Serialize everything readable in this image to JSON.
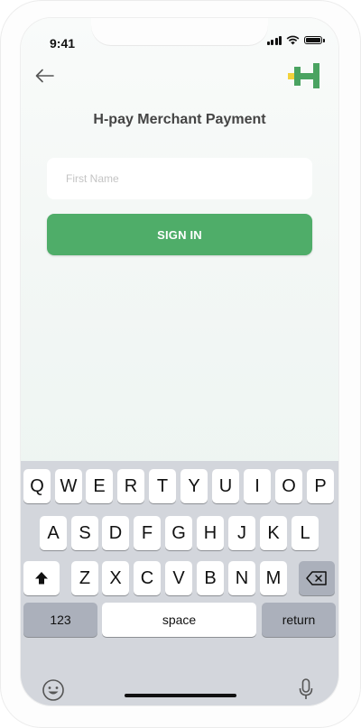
{
  "status_bar": {
    "time": "9:41"
  },
  "header": {
    "back_icon": "arrow-left-icon",
    "logo": "h-pay-logo",
    "title": "H-pay Merchant Payment"
  },
  "form": {
    "first_name": {
      "placeholder": "First Name",
      "value": ""
    },
    "submit_label": "SIGN IN"
  },
  "keyboard": {
    "row1": [
      "Q",
      "W",
      "E",
      "R",
      "T",
      "Y",
      "U",
      "I",
      "O",
      "P"
    ],
    "row2": [
      "A",
      "S",
      "D",
      "F",
      "G",
      "H",
      "J",
      "K",
      "L"
    ],
    "row3": [
      "Z",
      "X",
      "C",
      "V",
      "B",
      "N",
      "M"
    ],
    "numbers_label": "123",
    "space_label": "space",
    "return_label": "return",
    "shift_icon": "shift-icon",
    "backspace_icon": "backspace-icon",
    "emoji_icon": "emoji-icon",
    "mic_icon": "microphone-icon"
  },
  "colors": {
    "accent": "#4fad69",
    "logo_green": "#4aa361",
    "logo_yellow": "#f2d23a",
    "keyboard_bg": "#d3d6dc"
  }
}
